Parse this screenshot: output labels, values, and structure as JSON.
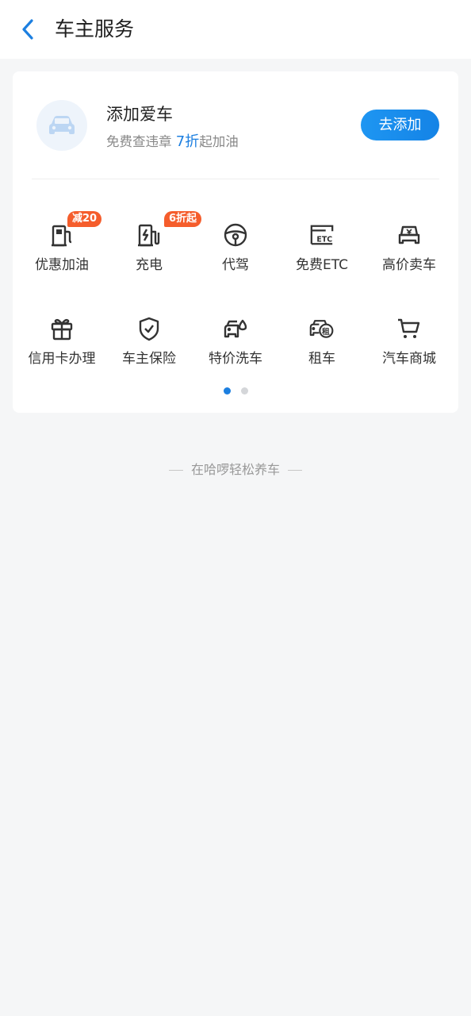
{
  "header": {
    "title": "车主服务",
    "back_icon": "chevron-left-icon",
    "accent_color": "#1c7fe0"
  },
  "add_car": {
    "icon": "car-icon",
    "title": "添加爱车",
    "subtitle_prefix": "免费查违章 ",
    "subtitle_highlight": "7折",
    "subtitle_suffix": "起加油",
    "button_label": "去添加"
  },
  "services": [
    {
      "label": "优惠加油",
      "icon": "gas-pump-icon",
      "badge": "减20"
    },
    {
      "label": "充电",
      "icon": "charging-station-icon",
      "badge": "6折起"
    },
    {
      "label": "代驾",
      "icon": "steering-wheel-icon",
      "badge": ""
    },
    {
      "label": "免费ETC",
      "icon": "etc-card-icon",
      "badge": ""
    },
    {
      "label": "高价卖车",
      "icon": "sell-car-icon",
      "badge": ""
    },
    {
      "label": "信用卡办理",
      "icon": "gift-icon",
      "badge": ""
    },
    {
      "label": "车主保险",
      "icon": "shield-check-icon",
      "badge": ""
    },
    {
      "label": "特价洗车",
      "icon": "car-wash-icon",
      "badge": ""
    },
    {
      "label": "租车",
      "icon": "car-rental-icon",
      "badge": ""
    },
    {
      "label": "汽车商城",
      "icon": "shopping-cart-icon",
      "badge": ""
    }
  ],
  "pagination": {
    "current": 1,
    "total": 2
  },
  "footer": {
    "slogan": "在哈啰轻松养车"
  }
}
